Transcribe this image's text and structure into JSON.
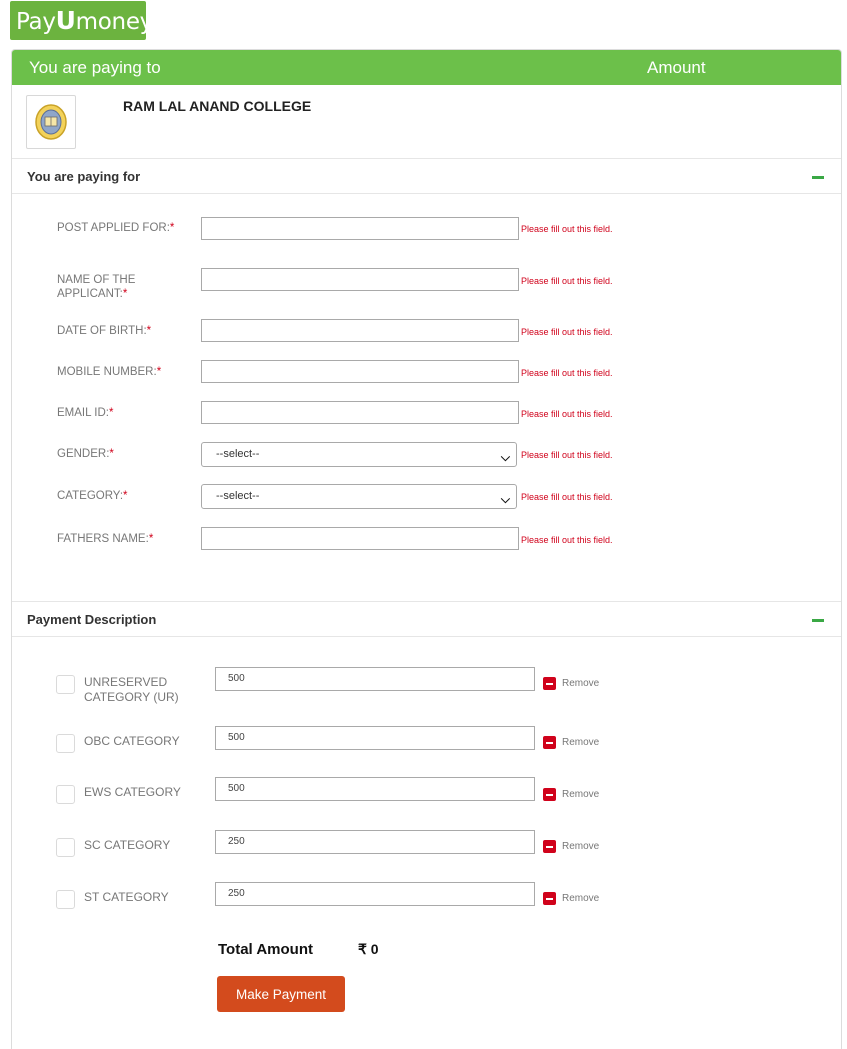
{
  "brand": {
    "logo_text_a": "Pay",
    "logo_text_u": "U",
    "logo_text_b": "money",
    "color": "#6cb33f"
  },
  "header": {
    "left": "You are paying to",
    "right": "Amount",
    "color": "#6cc04a"
  },
  "merchant": {
    "name": "RAM LAL ANAND COLLEGE"
  },
  "details": {
    "title": "You are paying for",
    "fields": [
      {
        "label": "POST APPLIED FOR:",
        "type": "text",
        "value": "",
        "error": "Please fill out this field."
      },
      {
        "label": "NAME OF THE APPLICANT:",
        "type": "text",
        "value": "",
        "error": "Please fill out this field."
      },
      {
        "label": "DATE OF BIRTH:",
        "type": "text",
        "value": "",
        "error": "Please fill out this field."
      },
      {
        "label": "MOBILE NUMBER:",
        "type": "text",
        "value": "",
        "error": "Please fill out this field."
      },
      {
        "label": "EMAIL ID:",
        "type": "text",
        "value": "",
        "error": "Please fill out this field."
      },
      {
        "label": "GENDER:",
        "type": "select",
        "value": "--select--",
        "error": "Please fill out this field."
      },
      {
        "label": "CATEGORY:",
        "type": "select",
        "value": "--select--",
        "error": "Please fill out this field."
      },
      {
        "label": "FATHERS NAME:",
        "type": "text",
        "value": "",
        "error": "Please fill out this field."
      }
    ],
    "required_mark": "*"
  },
  "payment": {
    "title": "Payment Description",
    "remove_label": "Remove",
    "items": [
      {
        "label": "UNRESERVED CATEGORY (UR)",
        "amount": "500",
        "checked": false
      },
      {
        "label": "OBC CATEGORY",
        "amount": "500",
        "checked": false
      },
      {
        "label": "EWS CATEGORY",
        "amount": "500",
        "checked": false
      },
      {
        "label": "SC CATEGORY",
        "amount": "250",
        "checked": false
      },
      {
        "label": "ST CATEGORY",
        "amount": "250",
        "checked": false
      }
    ],
    "total_label": "Total Amount",
    "total_value": "₹ 0",
    "pay_button": "Make Payment",
    "button_color": "#d34b1d"
  }
}
